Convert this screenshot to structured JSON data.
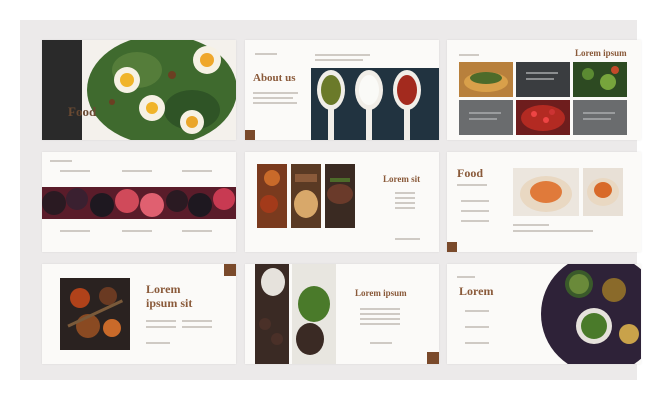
{
  "slides": {
    "s1": {
      "title": "Food"
    },
    "s2": {
      "title": "About us"
    },
    "s3": {
      "title": "Lorem ipsum"
    },
    "s5": {
      "title": "Lorem sit"
    },
    "s6": {
      "title": "Food"
    },
    "s7": {
      "title_line1": "Lorem",
      "title_line2": "ipsum sit"
    },
    "s8": {
      "title": "Lorem ipsum"
    },
    "s9": {
      "title": "Lorem"
    }
  },
  "colors": {
    "accent_brown": "#7a4a2b",
    "title_brown": "#8a5a3a",
    "dark_panel": "#3a3d40",
    "background": "#eceaea"
  }
}
